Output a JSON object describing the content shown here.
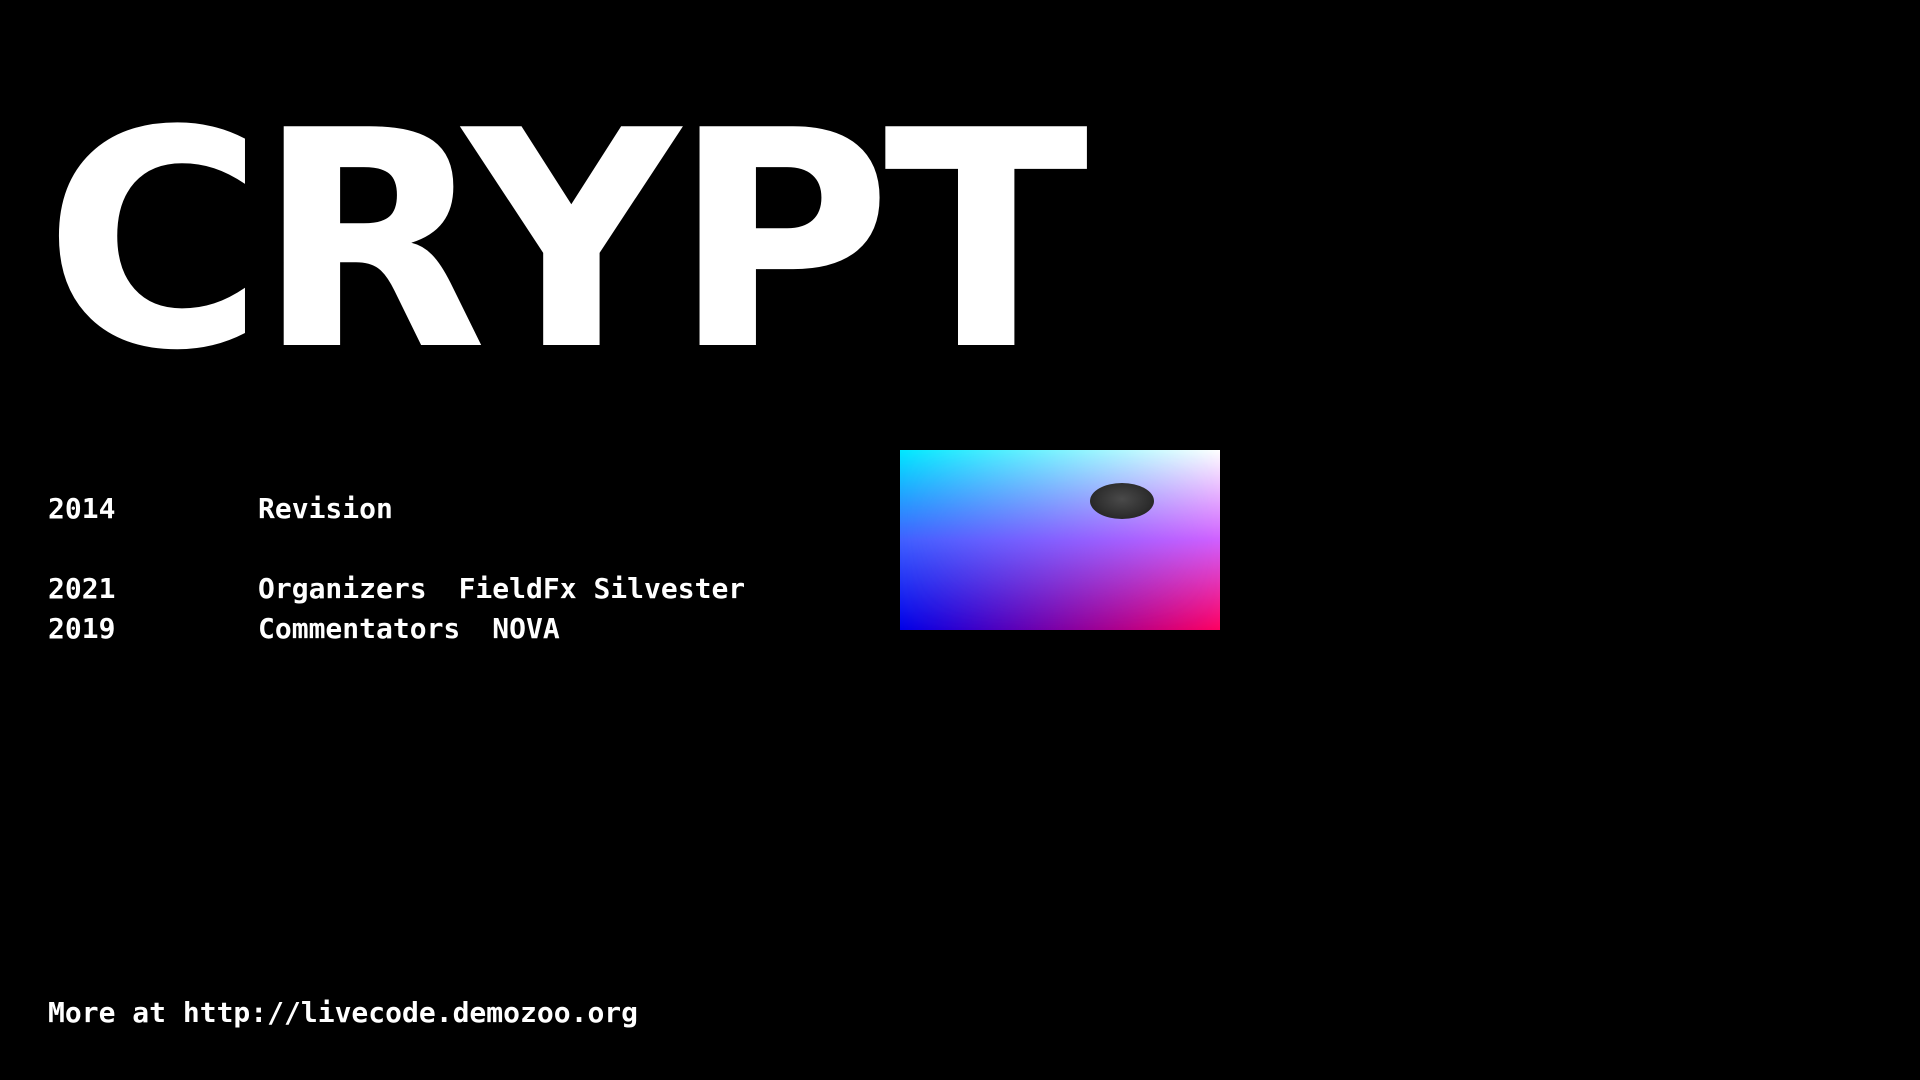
{
  "title": "CRYPT",
  "history": [
    {
      "year": "2014",
      "role": "Revision",
      "names": ""
    },
    {
      "year": "2021",
      "role": "Organizers",
      "names": "FieldFx Silvester"
    },
    {
      "year": "2019",
      "role": "Commentators",
      "names": "NOVA"
    }
  ],
  "footer": {
    "text": "More at http://livecode.demozoo.org"
  },
  "colors": {
    "background": "#000000",
    "text": "#ffffff",
    "preview_top_left": "#00e8ff",
    "preview_bottom_left": "#0000e8",
    "preview_top_right": "#ffffff",
    "preview_bottom_right": "#ff0060"
  }
}
